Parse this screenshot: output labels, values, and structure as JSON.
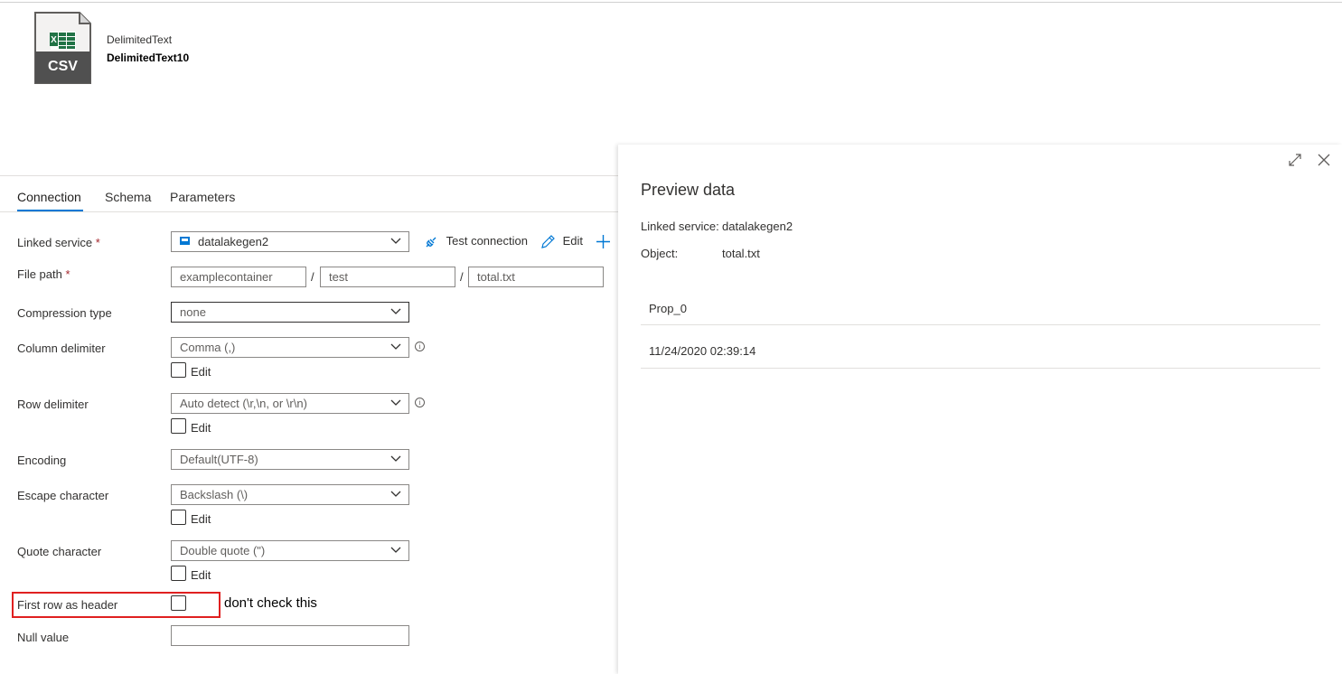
{
  "dataset": {
    "type": "DelimitedText",
    "name": "DelimitedText10",
    "icon": "csv-file-icon",
    "icon_text": "CSV"
  },
  "tabs": [
    {
      "label": "Connection",
      "active": true
    },
    {
      "label": "Schema",
      "active": false
    },
    {
      "label": "Parameters",
      "active": false
    }
  ],
  "connection": {
    "linked_service": {
      "label": "Linked service",
      "value": "datalakegen2",
      "test_label": "Test connection",
      "edit_label": "Edit"
    },
    "file_path": {
      "label": "File path",
      "container": "examplecontainer",
      "directory": "test",
      "file": "total.txt",
      "sep": "/"
    },
    "compression": {
      "label": "Compression type",
      "value": "none"
    },
    "column_delimiter": {
      "label": "Column delimiter",
      "value": "Comma (,)",
      "edit_label": "Edit"
    },
    "row_delimiter": {
      "label": "Row delimiter",
      "value": "Auto detect (\\r,\\n, or \\r\\n)",
      "edit_label": "Edit"
    },
    "encoding": {
      "label": "Encoding",
      "value": "Default(UTF-8)"
    },
    "escape_character": {
      "label": "Escape character",
      "value": "Backslash (\\)",
      "edit_label": "Edit"
    },
    "quote_character": {
      "label": "Quote character",
      "value": "Double quote (\")",
      "edit_label": "Edit"
    },
    "first_row_header": {
      "label": "First row as header",
      "checked": false
    },
    "annotation": "don't check this",
    "null_value": {
      "label": "Null value",
      "value": ""
    },
    "required_mark": "*"
  },
  "preview": {
    "title": "Preview data",
    "linked_service_label": "Linked service:",
    "linked_service_value": "datalakegen2",
    "object_label": "Object:",
    "object_value": "total.txt",
    "columns": [
      "Prop_0"
    ],
    "rows": [
      [
        "11/24/2020 02:39:14"
      ]
    ]
  },
  "colors": {
    "accent": "#0078d4",
    "annotation_box": "#e02020",
    "excel_green": "#217346"
  }
}
